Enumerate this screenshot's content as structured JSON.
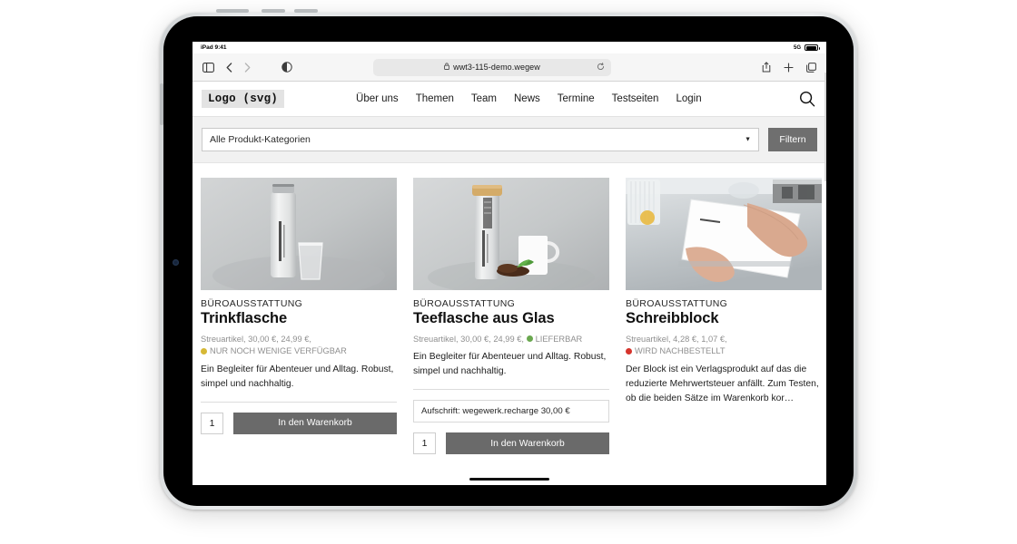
{
  "device": {
    "status_bar": {
      "left_label": "iPad 9:41",
      "network": "5G",
      "battery_icon": "battery-icon"
    }
  },
  "browser": {
    "sidebar_icon": "sidebar-icon",
    "back_icon": "chevron-left-icon",
    "forward_icon": "chevron-right-icon",
    "reader_icon": "reader-contrast-icon",
    "lock_icon": "lock-icon",
    "url": "wwt3-115-demo.wegew",
    "reload_icon": "reload-icon",
    "share_icon": "share-icon",
    "newtab_icon": "plus-icon",
    "tabs_icon": "tabs-icon"
  },
  "site": {
    "logo": "Logo (svg)",
    "nav": [
      {
        "label": "Über uns"
      },
      {
        "label": "Themen"
      },
      {
        "label": "Team"
      },
      {
        "label": "News"
      },
      {
        "label": "Termine"
      },
      {
        "label": "Testseiten"
      },
      {
        "label": "Login"
      }
    ],
    "search_icon": "search-icon"
  },
  "filter": {
    "category_value": "Alle Produkt-Kategorien",
    "caret_icon": "chevron-down-icon",
    "button_label": "Filtern"
  },
  "colors": {
    "status_low": "#d6b835",
    "status_available": "#6aa84f",
    "status_backorder": "#d6342c",
    "button_gray": "#6a6a6a",
    "filter_gray": "#6f6f6f"
  },
  "products": [
    {
      "image_name": "product-image-trinkflasche",
      "kicker": "BÜROAUSSTATTUNG",
      "title": "Trinkflasche",
      "meta": "Streuartikel, 30,00 €, 24,99 €,",
      "status_label": "NUR NOCH WENIGE VERFÜGBAR",
      "status_color": "#d6b835",
      "status_inline": false,
      "description": "Ein Begleiter für Abenteuer und Alltag. Robust, simpel und nachhaltig.",
      "variant": null,
      "quantity": "1",
      "cart_label": "In den Warenkorb"
    },
    {
      "image_name": "product-image-teeflasche",
      "kicker": "BÜROAUSSTATTUNG",
      "title": "Teeflasche aus Glas",
      "meta": "Streuartikel, 30,00 €, 24,99 €,",
      "status_label": "LIEFERBAR",
      "status_color": "#6aa84f",
      "status_inline": true,
      "description": "Ein Begleiter für Abenteuer und Alltag. Robust, simpel und nachhaltig.",
      "variant": "Aufschrift: wegewerk.recharge 30,00 €",
      "quantity": "1",
      "cart_label": "In den Warenkorb"
    },
    {
      "image_name": "product-image-schreibblock",
      "kicker": "BÜROAUSSTATTUNG",
      "title": "Schreibblock",
      "meta": "Streuartikel, 4,28 €, 1,07 €,",
      "status_label": "WIRD NACHBESTELLT",
      "status_color": "#d6342c",
      "status_inline": false,
      "description": "Der Block ist ein Verlagsprodukt auf das die reduzierte Mehrwertsteuer anfällt. Zum Testen, ob die beiden Sätze im Warenkorb kor…",
      "variant": null,
      "quantity": null,
      "cart_label": null
    }
  ]
}
